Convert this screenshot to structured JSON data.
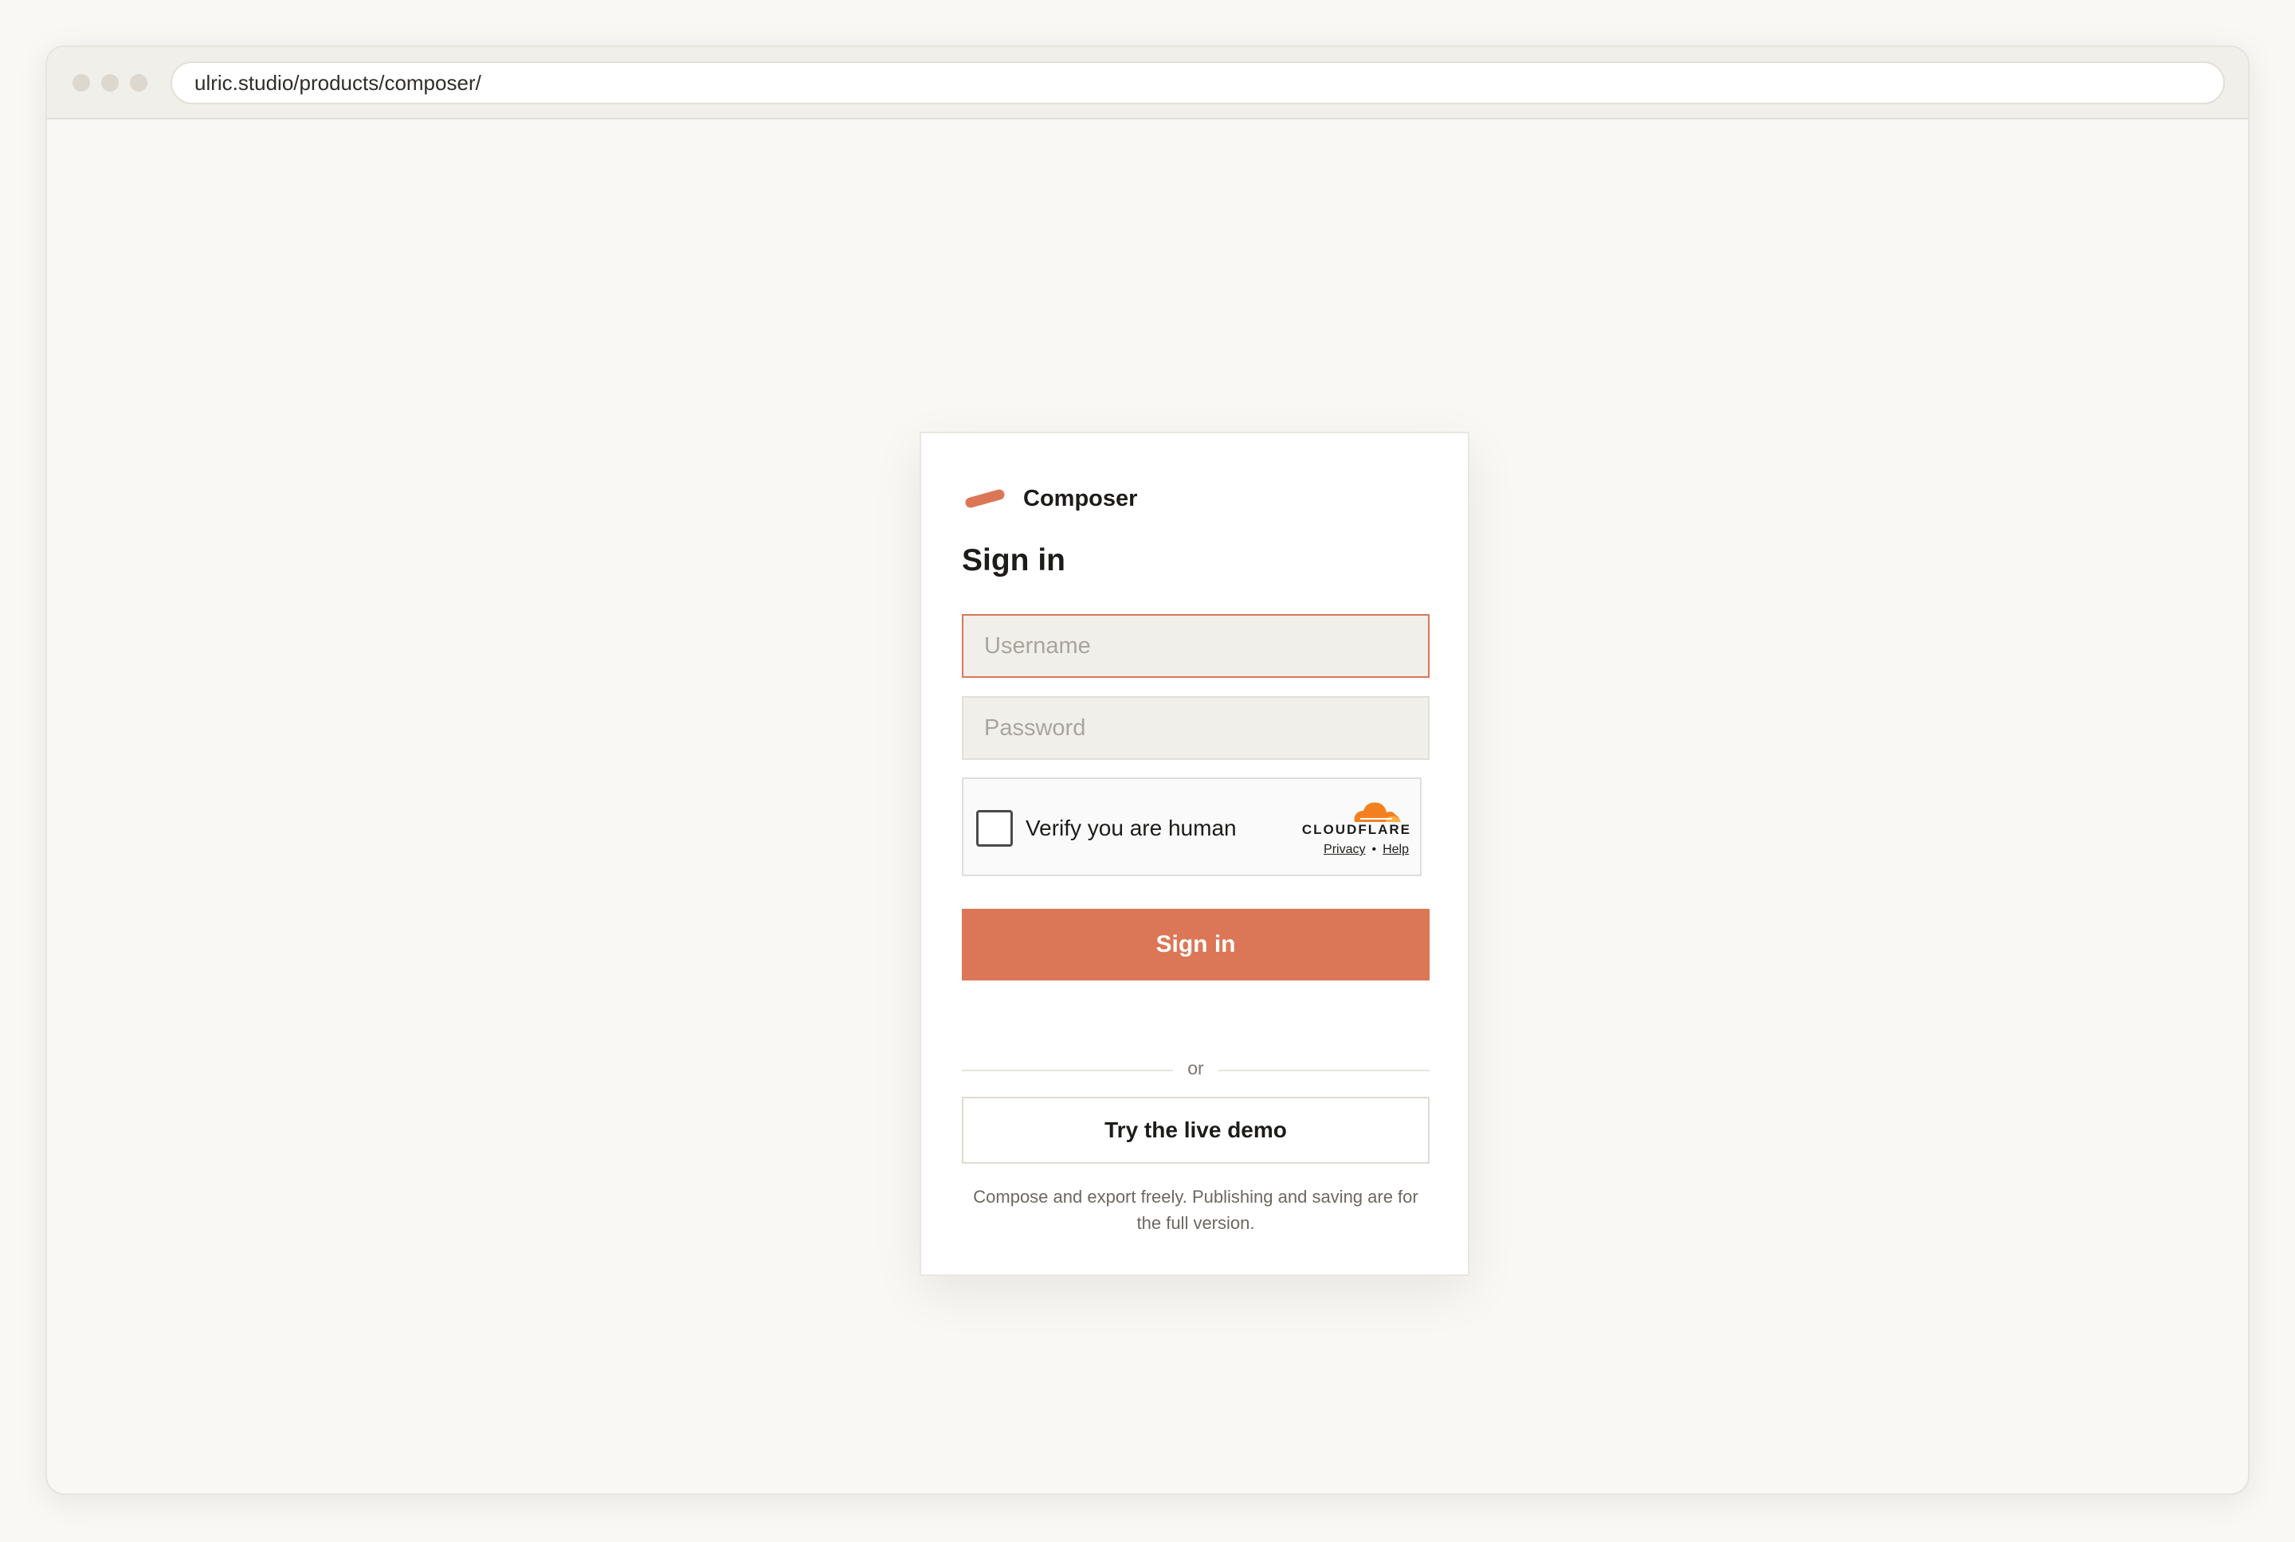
{
  "browser": {
    "url": "ulric.studio/products/composer/"
  },
  "brand": {
    "name": "Composer",
    "accent_color": "#db7756"
  },
  "form": {
    "heading": "Sign in",
    "username_placeholder": "Username",
    "password_placeholder": "Password",
    "submit_label": "Sign in"
  },
  "captcha": {
    "label": "Verify you are human",
    "provider": "CLOUDFLARE",
    "privacy_link": "Privacy",
    "separator": "•",
    "help_link": "Help"
  },
  "alt": {
    "divider_label": "or",
    "demo_label": "Try the live demo",
    "note": "Compose and export freely. Publishing and saving are for the full version."
  }
}
